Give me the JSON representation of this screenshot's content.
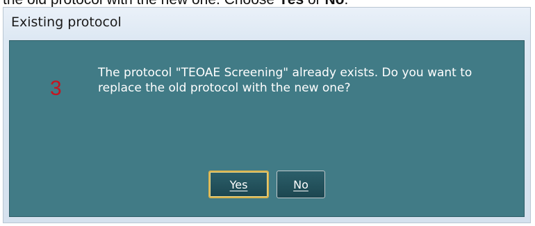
{
  "instruction": {
    "prefix": "the old protocol with the new one. Choose ",
    "yes": "Yes",
    "middle": " or ",
    "no": "No",
    "suffix": "."
  },
  "dialog": {
    "title": "Existing protocol",
    "step_number": "3",
    "message": "The protocol \"TEOAE Screening\" already exists. Do you want to replace the old protocol with the new one?",
    "buttons": {
      "yes_label": "Yes",
      "no_label": "No"
    }
  },
  "colors": {
    "client_background": "#417b86",
    "step_number": "#c8141e",
    "button_background": "#1c4650",
    "default_button_border": "#d8b24c"
  }
}
